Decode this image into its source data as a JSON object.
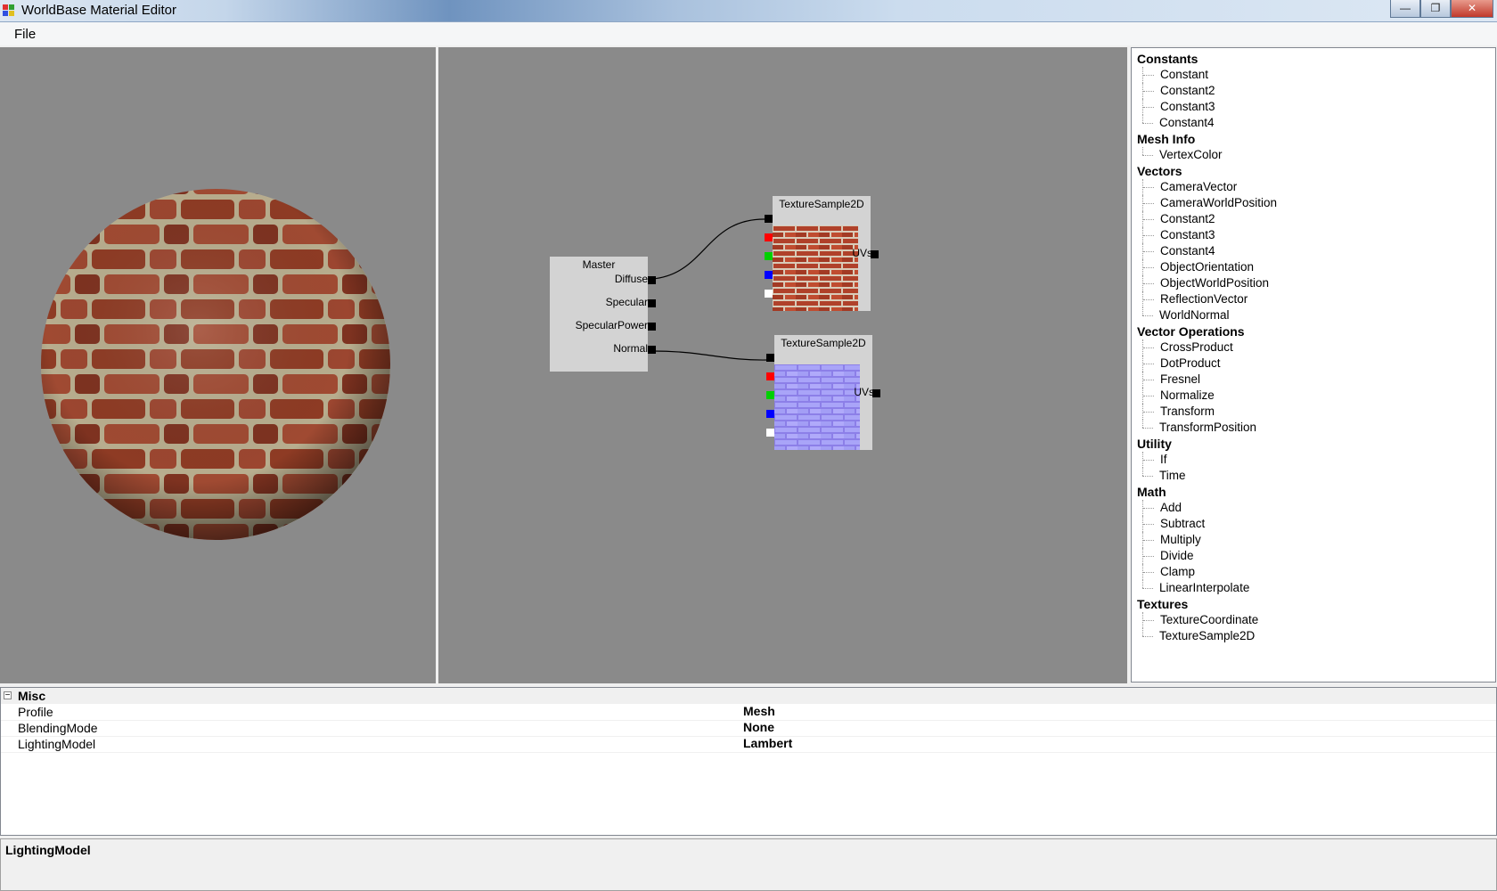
{
  "window": {
    "title": "WorldBase Material Editor",
    "minimize": "—",
    "maximize": "❐",
    "close": "✕"
  },
  "menu": {
    "file": "File"
  },
  "graph": {
    "master": {
      "title": "Master",
      "ports": [
        "Diffuse",
        "Specular",
        "SpecularPower",
        "Normal"
      ]
    },
    "nodes": [
      {
        "title": "TextureSample2D",
        "output": "UVs",
        "texture": "brick-diffuse"
      },
      {
        "title": "TextureSample2D",
        "output": "UVs",
        "texture": "brick-normal"
      }
    ],
    "channel_colors": [
      "#ff0000",
      "#00d000",
      "#0000ff",
      "#ffffff"
    ]
  },
  "palette": {
    "categories": [
      {
        "name": "Constants",
        "items": [
          "Constant",
          "Constant2",
          "Constant3",
          "Constant4"
        ]
      },
      {
        "name": "Mesh Info",
        "items": [
          "VertexColor"
        ]
      },
      {
        "name": "Vectors",
        "items": [
          "CameraVector",
          "CameraWorldPosition",
          "Constant2",
          "Constant3",
          "Constant4",
          "ObjectOrientation",
          "ObjectWorldPosition",
          "ReflectionVector",
          "WorldNormal"
        ]
      },
      {
        "name": "Vector Operations",
        "items": [
          "CrossProduct",
          "DotProduct",
          "Fresnel",
          "Normalize",
          "Transform",
          "TransformPosition"
        ]
      },
      {
        "name": "Utility",
        "items": [
          "If",
          "Time"
        ]
      },
      {
        "name": "Math",
        "items": [
          "Add",
          "Subtract",
          "Multiply",
          "Divide",
          "Clamp",
          "LinearInterpolate"
        ]
      },
      {
        "name": "Textures",
        "items": [
          "TextureCoordinate",
          "TextureSample2D"
        ]
      }
    ]
  },
  "properties": {
    "category": "Misc",
    "expander": "−",
    "rows": [
      {
        "name": "Profile",
        "value": "Mesh"
      },
      {
        "name": "BlendingMode",
        "value": "None"
      },
      {
        "name": "LightingModel",
        "value": "Lambert"
      }
    ],
    "help_title": "LightingModel"
  }
}
